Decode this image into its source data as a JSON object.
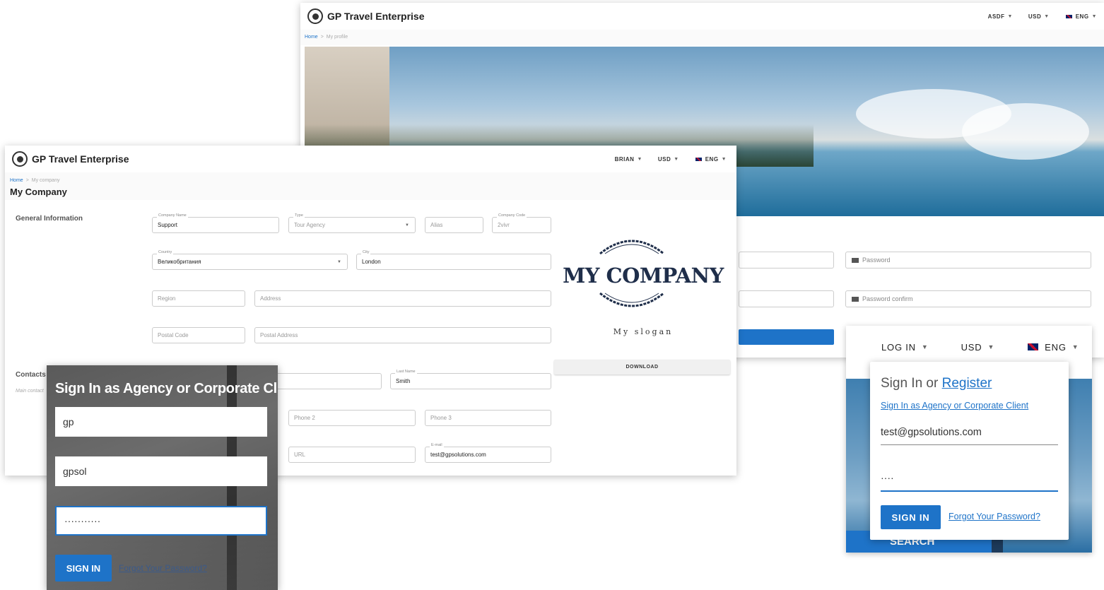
{
  "brand": "GP Travel Enterprise",
  "profile_window": {
    "nav": {
      "user": "ASDF",
      "currency": "USD",
      "language": "ENG"
    },
    "breadcrumb": {
      "home": "Home",
      "separator": ">",
      "current": "My profile"
    },
    "fields": {
      "password": "Password",
      "password_confirm": "Password confirm"
    }
  },
  "company_window": {
    "nav": {
      "user": "BRIAN",
      "currency": "USD",
      "language": "ENG"
    },
    "breadcrumb": {
      "home": "Home",
      "separator": ">",
      "current": "My company"
    },
    "title": "My Company",
    "general": {
      "heading": "General Information",
      "company_name": {
        "label": "Company Name",
        "value": "Support"
      },
      "type": {
        "label": "Type",
        "value": "Tour Agency"
      },
      "alias": {
        "placeholder": "Alias"
      },
      "company_code": {
        "label": "Company Code",
        "value": "2vivr"
      },
      "country": {
        "label": "Country",
        "value": "Великобритания"
      },
      "city": {
        "label": "City",
        "value": "London"
      },
      "region": {
        "placeholder": "Region"
      },
      "address": {
        "placeholder": "Address"
      },
      "postal_code": {
        "placeholder": "Postal Code"
      },
      "postal_address": {
        "placeholder": "Postal Address"
      }
    },
    "contacts": {
      "heading": "Contacts",
      "subheading": "Main contact",
      "last_name": {
        "label": "Last Name",
        "value": "Smith"
      },
      "phone2": {
        "placeholder": "Phone 2"
      },
      "phone3": {
        "placeholder": "Phone 3"
      },
      "url": {
        "placeholder": "URL"
      },
      "email": {
        "label": "E-mail",
        "value": "test@gpsolutions.com"
      }
    },
    "logo": {
      "name": "MY COMPANY",
      "slogan": "My slogan"
    },
    "download_label": "DOWNLOAD"
  },
  "agency_window": {
    "title": "Sign In as Agency or Corporate Client",
    "field1": "gp",
    "field2": "gpsol",
    "password_mask": "···········",
    "signin_label": "SIGN IN",
    "forgot_label": "Forgot Your Password?"
  },
  "login_window": {
    "nav": {
      "login": "LOG IN",
      "currency": "USD",
      "language": "ENG"
    },
    "head_text": "Sign In or",
    "register_link": "Register",
    "agency_link": "Sign In as Agency or Corporate Client",
    "email_value": "test@gpsolutions.com",
    "password_mask": "····",
    "signin_label": "SIGN IN",
    "forgot_label": "Forgot Your Password?",
    "search_label": "SEARCH"
  },
  "colors": {
    "accent": "#1e73c8",
    "logo_navy": "#1f2e4a"
  }
}
